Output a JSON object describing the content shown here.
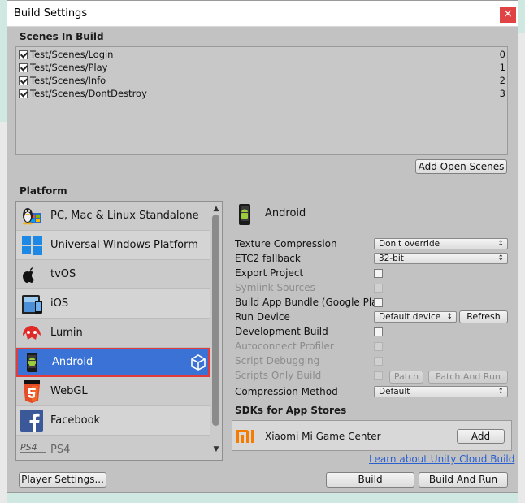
{
  "window": {
    "title": "Build Settings",
    "close_glyph": "×"
  },
  "scenes": {
    "header": "Scenes In Build",
    "items": [
      {
        "name": "Test/Scenes/Login",
        "index": "0",
        "checked": true
      },
      {
        "name": "Test/Scenes/Play",
        "index": "1",
        "checked": true
      },
      {
        "name": "Test/Scenes/Info",
        "index": "2",
        "checked": true
      },
      {
        "name": "Test/Scenes/DontDestroy",
        "index": "3",
        "checked": true
      }
    ],
    "add_open_scenes": "Add Open Scenes"
  },
  "platform": {
    "header": "Platform",
    "items": [
      {
        "label": "PC, Mac & Linux Standalone",
        "icon": "standalone-icon"
      },
      {
        "label": "Universal Windows Platform",
        "icon": "windows-icon"
      },
      {
        "label": "tvOS",
        "icon": "apple-tv-icon"
      },
      {
        "label": "iOS",
        "icon": "ios-device-icon"
      },
      {
        "label": "Lumin",
        "icon": "lumin-icon"
      },
      {
        "label": "Android",
        "icon": "android-icon",
        "selected": true
      },
      {
        "label": "WebGL",
        "icon": "html5-icon"
      },
      {
        "label": "Facebook",
        "icon": "facebook-icon"
      },
      {
        "label": "PS4",
        "icon": "ps4-icon"
      }
    ]
  },
  "settings": {
    "platform_title": "Android",
    "texture_compression": {
      "label": "Texture Compression",
      "value": "Don't override"
    },
    "etc2_fallback": {
      "label": "ETC2 fallback",
      "value": "32-bit"
    },
    "export_project": {
      "label": "Export Project"
    },
    "symlink_sources": {
      "label": "Symlink Sources"
    },
    "build_app_bundle": {
      "label": "Build App Bundle (Google Play)"
    },
    "run_device": {
      "label": "Run Device",
      "value": "Default device",
      "refresh": "Refresh"
    },
    "development_build": {
      "label": "Development Build"
    },
    "autoconnect_profiler": {
      "label": "Autoconnect Profiler"
    },
    "script_debugging": {
      "label": "Script Debugging"
    },
    "scripts_only_build": {
      "label": "Scripts Only Build",
      "patch": "Patch",
      "patch_and_run": "Patch And Run"
    },
    "compression_method": {
      "label": "Compression Method",
      "value": "Default"
    }
  },
  "sdks": {
    "header": "SDKs for App Stores",
    "item": {
      "name": "Xiaomi Mi Game Center",
      "logo": "mi-logo-icon",
      "add": "Add"
    },
    "link": "Learn about Unity Cloud Build"
  },
  "footer": {
    "player_settings": "Player Settings...",
    "build": "Build",
    "build_and_run": "Build And Run"
  },
  "colors": {
    "selection": "#3a72d6",
    "selection_border": "#e23b3b",
    "link": "#2a5fd0",
    "close": "#e04343"
  }
}
